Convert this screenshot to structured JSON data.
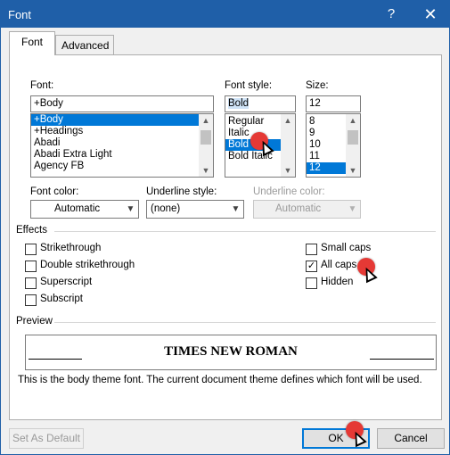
{
  "window": {
    "title": "Font",
    "help_glyph": "?",
    "close_glyph": "✕"
  },
  "tabs": [
    {
      "label": "Font",
      "active": true
    },
    {
      "label": "Advanced",
      "active": false
    }
  ],
  "font": {
    "label": "Font:",
    "value": "+Body",
    "list": [
      "+Body",
      "+Headings",
      "Abadi",
      "Abadi Extra Light",
      "Agency FB"
    ],
    "selected": "+Body"
  },
  "style": {
    "label": "Font style:",
    "value": "Bold",
    "list": [
      "Regular",
      "Italic",
      "Bold",
      "Bold Italic"
    ],
    "selected": "Bold"
  },
  "size": {
    "label": "Size:",
    "value": "12",
    "list": [
      "8",
      "9",
      "10",
      "11",
      "12"
    ],
    "selected": "12"
  },
  "font_color": {
    "label": "Font color:",
    "value": "Automatic"
  },
  "underline_style": {
    "label": "Underline style:",
    "value": "(none)"
  },
  "underline_color": {
    "label": "Underline color:",
    "value": "Automatic"
  },
  "effects": {
    "title": "Effects",
    "left": [
      {
        "label": "Strikethrough",
        "checked": false
      },
      {
        "label": "Double strikethrough",
        "checked": false
      },
      {
        "label": "Superscript",
        "checked": false
      },
      {
        "label": "Subscript",
        "checked": false
      }
    ],
    "right": [
      {
        "label": "Small caps",
        "checked": false
      },
      {
        "label": "All caps",
        "checked": true
      },
      {
        "label": "Hidden",
        "checked": false
      }
    ]
  },
  "preview": {
    "title": "Preview",
    "text": "TIMES NEW ROMAN",
    "description": "This is the body theme font. The current document theme defines which font will be used."
  },
  "buttons": {
    "set_default": "Set As Default",
    "ok": "OK",
    "cancel": "Cancel"
  },
  "colors": {
    "accent": "#1f5fa8",
    "selection": "#0078d7",
    "marker": "#e53935"
  }
}
